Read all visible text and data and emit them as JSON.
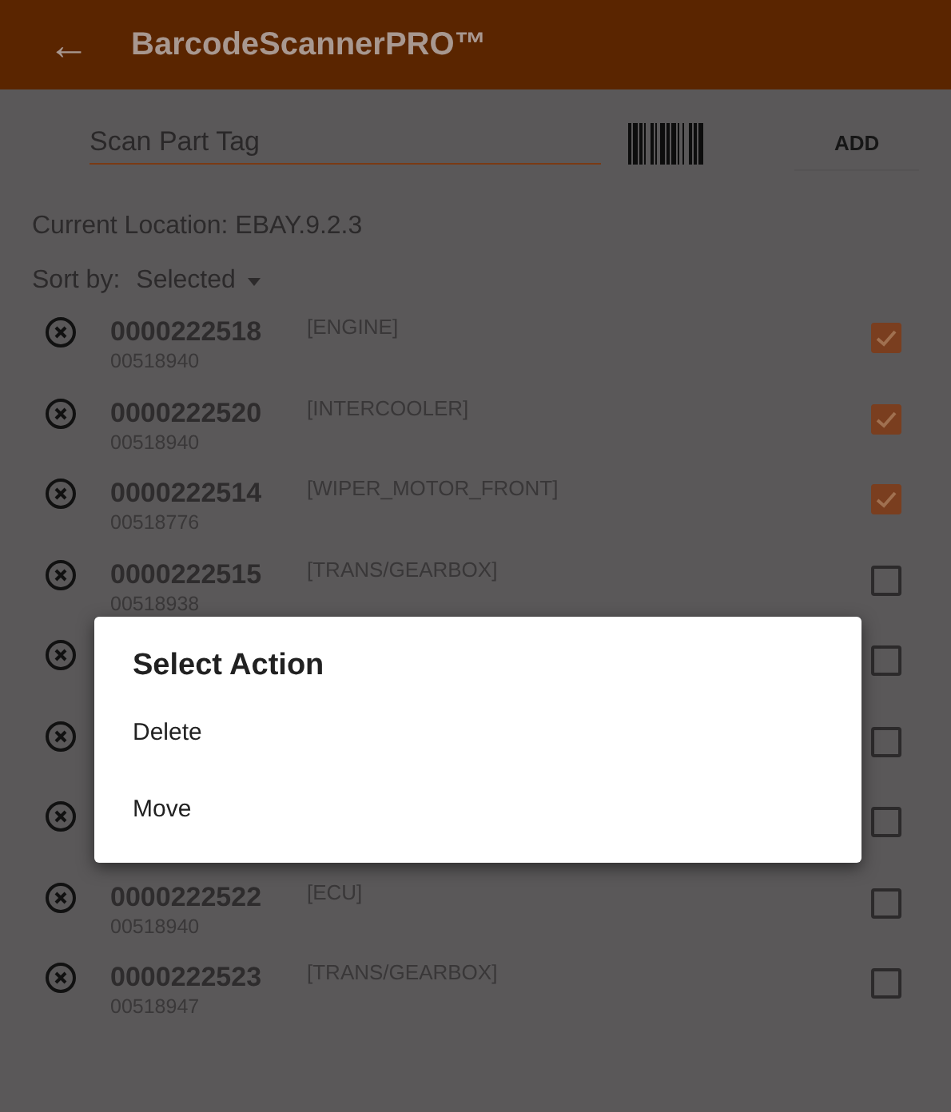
{
  "app_bar": {
    "back_icon": "←",
    "title": "BarcodeScannerPRO™"
  },
  "scan": {
    "placeholder": "Scan Part Tag",
    "button": "ADD"
  },
  "location": "Current Location: EBAY.9.2.3",
  "sort": {
    "label": "Sort by:",
    "value": "Selected"
  },
  "rows": [
    {
      "number": "0000222518",
      "sub": "00518940",
      "category": "[ENGINE]",
      "checked": true
    },
    {
      "number": "0000222520",
      "sub": "00518940",
      "category": "[INTERCOOLER]",
      "checked": true
    },
    {
      "number": "0000222514",
      "sub": "00518776",
      "category": "[WIPER_MOTOR_FRONT]",
      "checked": true
    },
    {
      "number": "0000222515",
      "sub": "00518938",
      "category": "[TRANS/GEARBOX]",
      "checked": false
    },
    {
      "checked": false
    },
    {
      "checked": false
    },
    {
      "checked": false
    },
    {
      "number": "0000222522",
      "sub": "00518940",
      "category": "[ECU]",
      "checked": false
    },
    {
      "number": "0000222523",
      "sub": "00518947",
      "category": "[TRANS/GEARBOX]",
      "checked": false
    }
  ],
  "dialog": {
    "title": "Select Action",
    "options": [
      "Delete",
      "Move"
    ]
  }
}
